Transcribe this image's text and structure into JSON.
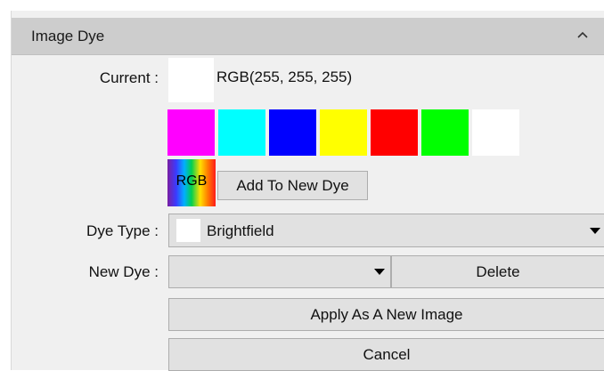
{
  "panel": {
    "title": "Image Dye",
    "collapse_icon": "chevron-up-icon"
  },
  "current": {
    "label": "Current :",
    "value": "RGB(255, 255, 255)",
    "swatch_color": "#ffffff"
  },
  "palette": {
    "swatches": [
      {
        "name": "magenta",
        "color": "#ff00ff"
      },
      {
        "name": "cyan",
        "color": "#00ffff"
      },
      {
        "name": "blue",
        "color": "#0000ff"
      },
      {
        "name": "yellow",
        "color": "#ffff00"
      },
      {
        "name": "red",
        "color": "#ff0000"
      },
      {
        "name": "green",
        "color": "#00ff00"
      },
      {
        "name": "white",
        "color": "#ffffff"
      }
    ],
    "rgb_label": "RGB",
    "add_button_label": "Add To New Dye"
  },
  "dye_type": {
    "label": "Dye Type :",
    "value": "Brightfield",
    "swatch_color": "#ffffff",
    "dropdown_icon": "dropdown-arrow-icon"
  },
  "new_dye": {
    "label": "New Dye :",
    "value": "",
    "dropdown_icon": "dropdown-arrow-icon",
    "delete_label": "Delete"
  },
  "actions": {
    "apply_label": "Apply As A New Image",
    "cancel_label": "Cancel"
  }
}
